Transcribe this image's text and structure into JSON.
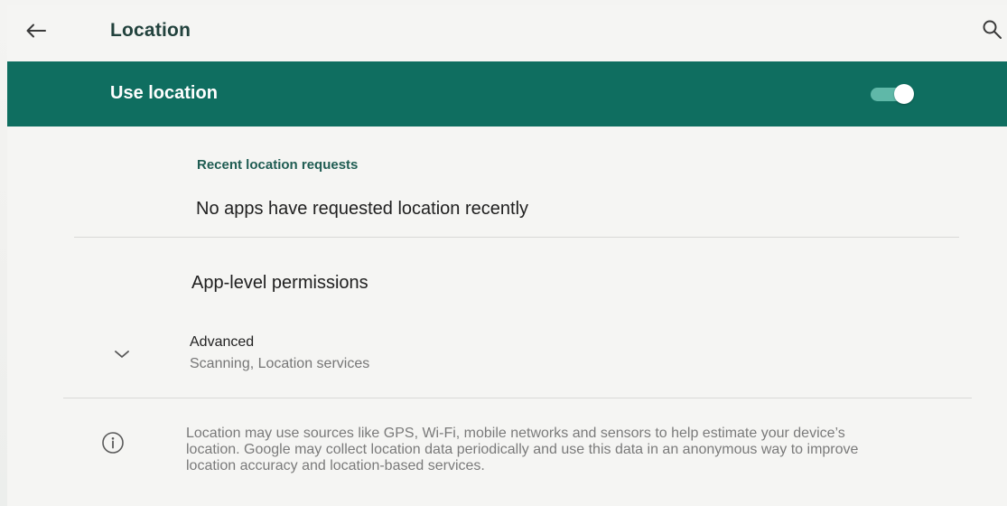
{
  "app_bar": {
    "title": "Location",
    "back_icon": "arrow-left-icon",
    "search_icon": "search-icon"
  },
  "master_switch": {
    "label": "Use location",
    "state": "on",
    "bar_color": "#0f6e60"
  },
  "recent_requests": {
    "header": "Recent location requests",
    "empty_text": "No apps have requested location recently"
  },
  "app_permissions": {
    "label": "App-level permissions"
  },
  "advanced": {
    "title": "Advanced",
    "summary": "Scanning, Location services",
    "icon": "chevron-down-icon"
  },
  "footer": {
    "icon": "info-icon",
    "text": "Location may use sources like GPS, Wi-Fi, mobile networks and sensors to help estimate your device’s location. Google may collect location data periodically and use this data in an anonymous way to improve location accuracy and location-based services."
  }
}
